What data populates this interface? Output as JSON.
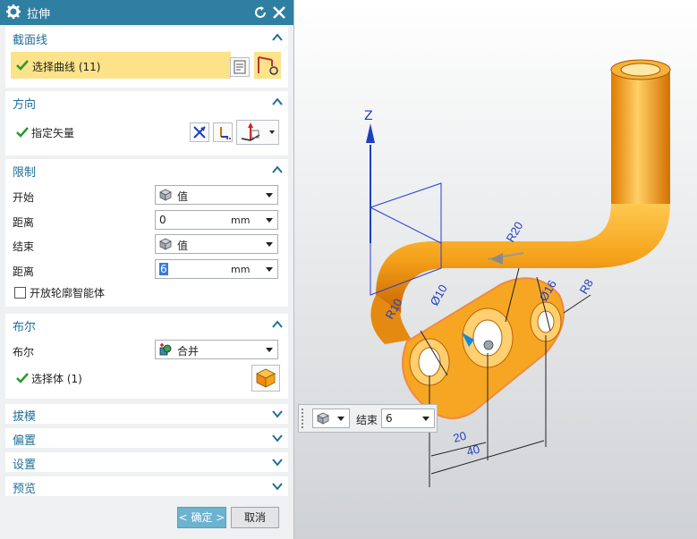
{
  "dialog": {
    "title": "拉伸"
  },
  "sections": {
    "section_curve": {
      "title": "截面线",
      "select_label": "选择曲线 (11)"
    },
    "direction": {
      "title": "方向",
      "vector_label": "指定矢量"
    },
    "limits": {
      "title": "限制",
      "start_label": "开始",
      "start_value": "值",
      "start_distance_label": "距离",
      "start_distance": "0",
      "end_label": "结束",
      "end_value": "值",
      "end_distance_label": "距离",
      "end_distance": "6",
      "unit": "mm",
      "open_profile_label": "开放轮廓智能体"
    },
    "boolean": {
      "title": "布尔",
      "bool_label": "布尔",
      "bool_value": "合并",
      "select_body": "选择体 (1)"
    },
    "draft": {
      "title": "拔模"
    },
    "offset": {
      "title": "偏置"
    },
    "settings": {
      "title": "设置"
    },
    "preview": {
      "title": "预览"
    }
  },
  "buttons": {
    "ok": "< 确定 >",
    "cancel": "取消"
  },
  "viewport": {
    "axis_label": "Z",
    "dims": {
      "r20": "R20",
      "r10": "R10",
      "phi10": "Ø10",
      "phi16": "Ø16",
      "r8": "R8",
      "d20": "20",
      "d40": "40"
    }
  },
  "floating_toolbar": {
    "end_label": "结束",
    "end_value": "6"
  },
  "colors": {
    "title_bar": "#2f7fa2",
    "accent_text": "#1f6e99",
    "highlight": "#fce38a",
    "part": "#f5a21a",
    "ok_button": "#6cb3cf"
  }
}
